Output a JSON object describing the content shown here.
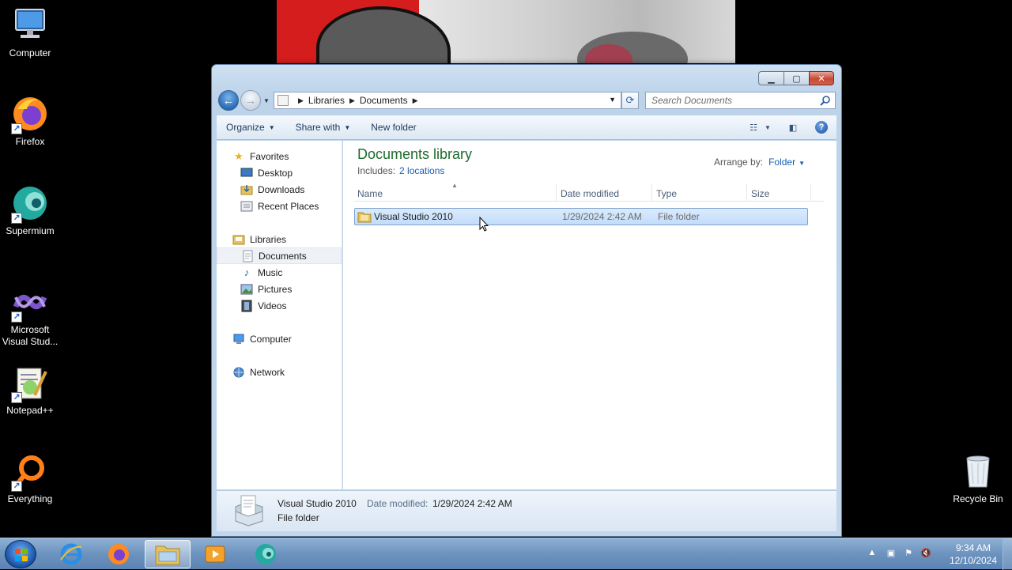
{
  "desktop": {
    "icons": [
      {
        "label": "Computer"
      },
      {
        "label": "Firefox"
      },
      {
        "label": "Supermium"
      },
      {
        "label": "Microsoft Visual Stud..."
      },
      {
        "label": "Notepad++"
      },
      {
        "label": "Everything"
      },
      {
        "label": "Recycle Bin"
      }
    ]
  },
  "window": {
    "breadcrumb": [
      "Libraries",
      "Documents"
    ],
    "search_placeholder": "Search Documents",
    "toolbar": {
      "organize": "Organize",
      "share_with": "Share with",
      "new_folder": "New folder"
    },
    "nav": {
      "favorites": "Favorites",
      "desktop": "Desktop",
      "downloads": "Downloads",
      "recent_places": "Recent Places",
      "libraries": "Libraries",
      "documents": "Documents",
      "music": "Music",
      "pictures": "Pictures",
      "videos": "Videos",
      "computer": "Computer",
      "network": "Network"
    },
    "library": {
      "title": "Documents library",
      "includes_label": "Includes:",
      "includes_link": "2 locations",
      "arrange_label": "Arrange by:",
      "arrange_value": "Folder"
    },
    "columns": {
      "name": "Name",
      "date": "Date modified",
      "type": "Type",
      "size": "Size"
    },
    "files": [
      {
        "name": "Visual Studio 2010",
        "date": "1/29/2024 2:42 AM",
        "type": "File folder",
        "size": ""
      }
    ],
    "details": {
      "name": "Visual Studio 2010",
      "date_label": "Date modified:",
      "date": "1/29/2024 2:42 AM",
      "type": "File folder"
    }
  },
  "taskbar": {
    "clock_time": "9:34 AM",
    "clock_date": "12/10/2024"
  },
  "colors": {
    "accent": "#1a5fb4",
    "library_title": "#1e6b2e",
    "selection": "#c1dcfb",
    "close_button": "#c64a36"
  }
}
